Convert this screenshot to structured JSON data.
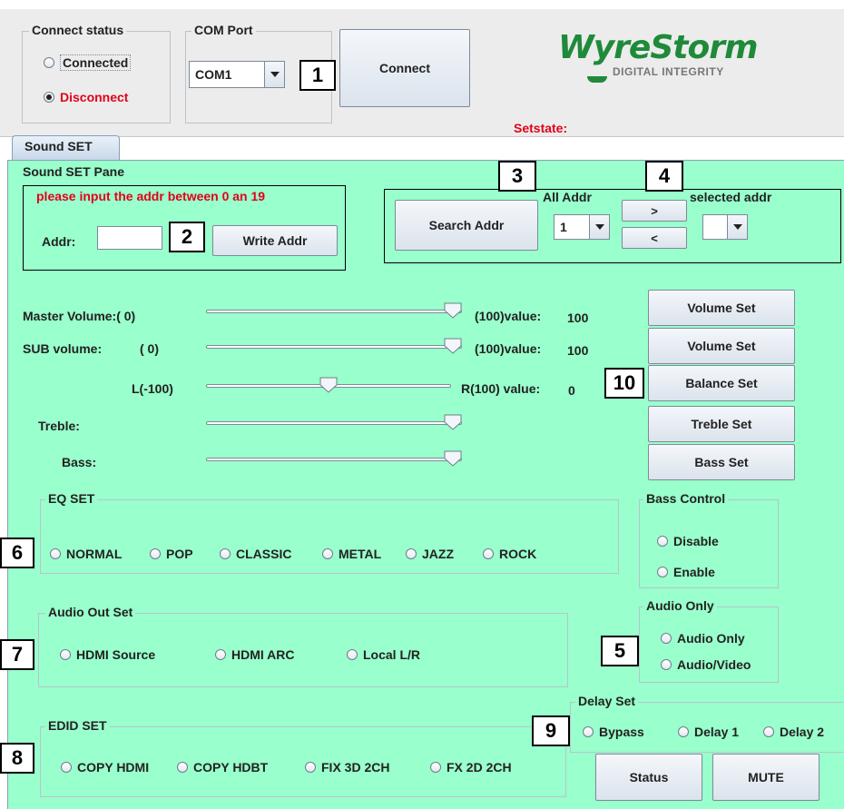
{
  "connect_status": {
    "title": "Connect status",
    "connected_label": "Connected",
    "disconnect_label": "Disconnect"
  },
  "com_port": {
    "title": "COM Port",
    "selected": "COM1"
  },
  "connect_button": "Connect",
  "logo": {
    "brand": "WyreStorm",
    "tagline": "DIGITAL INTEGRITY"
  },
  "setstate_label": "Setstate:",
  "tab_label": "Sound SET",
  "pane_title": "Sound SET Pane",
  "addr_panel": {
    "hint": "please input the addr between 0 an 19",
    "addr_label": "Addr:",
    "addr_value": "",
    "write_button": "Write Addr"
  },
  "search_panel": {
    "search_button": "Search Addr",
    "all_addr_label": "All Addr",
    "all_addr_value": "1",
    "next_button": ">",
    "prev_button": "<",
    "selected_addr_label": "selected addr",
    "selected_addr_value": ""
  },
  "sliders": {
    "master": {
      "label": "Master Volume:( 0)",
      "max_label": "(100)value:",
      "value": "100",
      "level": 1.0
    },
    "sub": {
      "label": "SUB volume:",
      "min": "( 0)",
      "max_label": "(100)value:",
      "value": "100",
      "level": 1.0
    },
    "balance": {
      "min_label": "L(-100)",
      "max_label": "R(100) value:",
      "value": "0",
      "level": 0.5
    },
    "treble": {
      "label": "Treble:",
      "level": 1.0
    },
    "bass": {
      "label": "Bass:",
      "level": 1.0
    }
  },
  "set_buttons": {
    "volume": "Volume Set",
    "sub_volume": "Volume Set",
    "balance": "Balance Set",
    "treble": "Treble Set",
    "bass": "Bass Set"
  },
  "eq_set": {
    "title": "EQ SET",
    "options": [
      "NORMAL",
      "POP",
      "CLASSIC",
      "METAL",
      "JAZZ",
      "ROCK"
    ]
  },
  "bass_control": {
    "title": "Bass Control",
    "options": [
      "Disable",
      "Enable"
    ]
  },
  "audio_out": {
    "title": "Audio Out Set",
    "options": [
      "HDMI Source",
      "HDMI ARC",
      "Local  L/R"
    ]
  },
  "audio_only": {
    "title": "Audio Only",
    "options": [
      "Audio Only",
      "Audio/Video"
    ]
  },
  "delay_set": {
    "title": "Delay Set",
    "options": [
      "Bypass",
      "Delay 1",
      "Delay 2"
    ]
  },
  "edid_set": {
    "title": "EDID SET",
    "options": [
      "COPY HDMI",
      "COPY HDBT",
      "FIX  3D 2CH",
      "FX 2D  2CH"
    ]
  },
  "status_button": "Status",
  "mute_button": "MUTE",
  "callouts": [
    "1",
    "2",
    "3",
    "4",
    "5",
    "6",
    "7",
    "8",
    "9",
    "10"
  ],
  "colors": {
    "panel_top": "#ececec",
    "pane_green": "#99ffcc",
    "disconnect_red": "#e2001a",
    "logo_green": "#1f8a3a"
  }
}
